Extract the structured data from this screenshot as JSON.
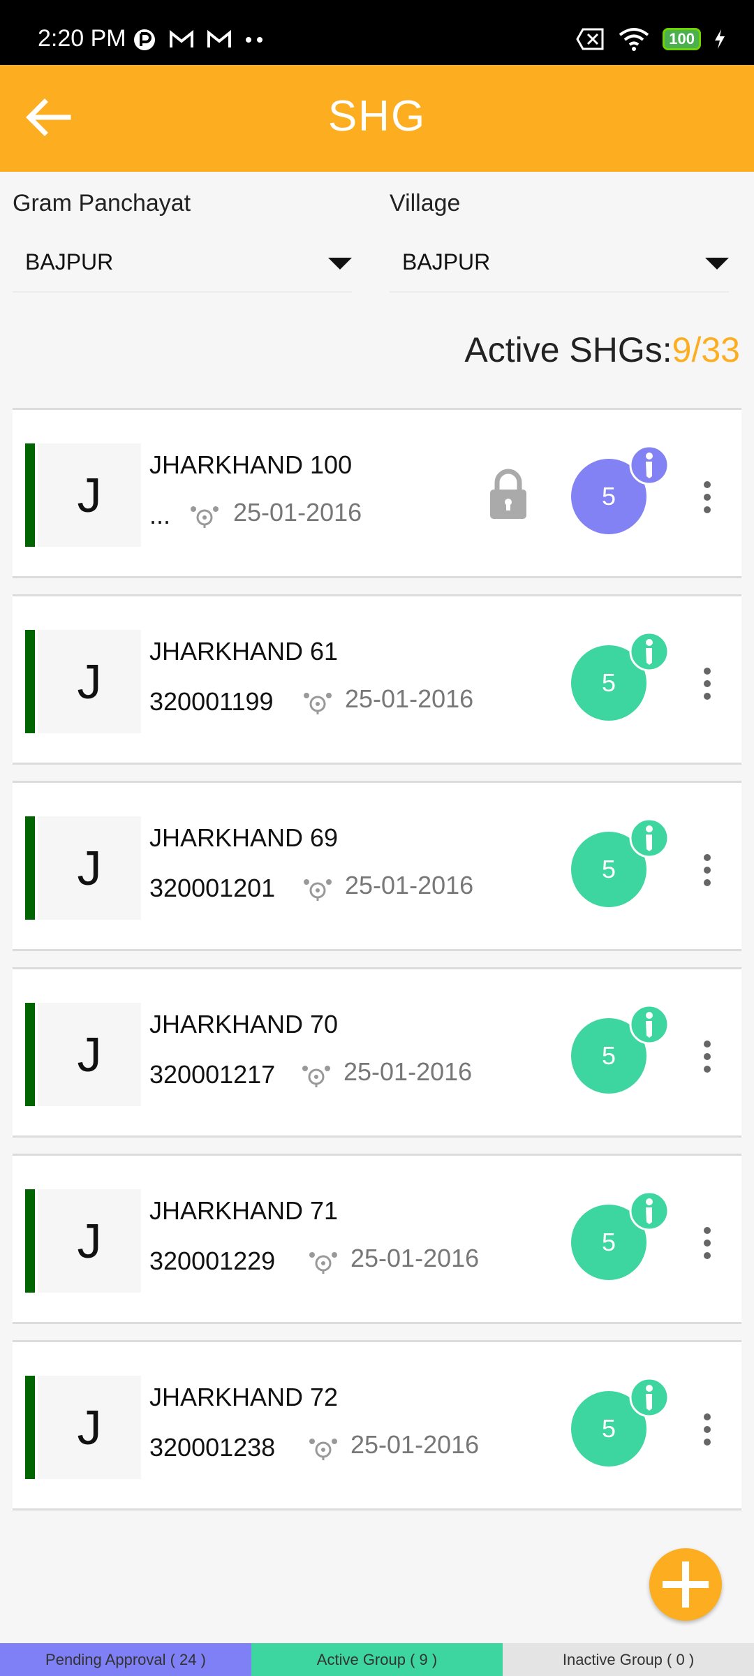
{
  "status_bar": {
    "time": "2:20 PM",
    "battery": "100",
    "icons": [
      "app-icon",
      "gmail-icon",
      "gmail-icon",
      "more-dots-icon",
      "sim-off-icon",
      "wifi-icon",
      "battery-icon",
      "charging-icon"
    ]
  },
  "app_bar": {
    "title": "SHG",
    "back_icon": "arrow-left-icon"
  },
  "filters": {
    "gram_panchayat": {
      "label": "Gram Panchayat",
      "value": "BAJPUR"
    },
    "village": {
      "label": "Village",
      "value": "BAJPUR"
    }
  },
  "active_shgs": {
    "label": "Active SHGs:",
    "value": "9/33"
  },
  "shg_list": [
    {
      "initial": "J",
      "name": "JHARKHAND 100",
      "code": "...",
      "date": "25-01-2016",
      "members": "5",
      "locked": true,
      "color": "#8282f5"
    },
    {
      "initial": "J",
      "name": "JHARKHAND 61",
      "code": "320001199",
      "date": "25-01-2016",
      "members": "5",
      "locked": false,
      "color": "#3dd6a0"
    },
    {
      "initial": "J",
      "name": "JHARKHAND 69",
      "code": "320001201",
      "date": "25-01-2016",
      "members": "5",
      "locked": false,
      "color": "#3dd6a0"
    },
    {
      "initial": "J",
      "name": "JHARKHAND 70",
      "code": "320001217",
      "date": "25-01-2016",
      "members": "5",
      "locked": false,
      "color": "#3dd6a0"
    },
    {
      "initial": "J",
      "name": "JHARKHAND 71",
      "code": "320001229",
      "date": "25-01-2016",
      "members": "5",
      "locked": false,
      "color": "#3dd6a0"
    },
    {
      "initial": "J",
      "name": "JHARKHAND 72",
      "code": "320001238",
      "date": "25-01-2016",
      "members": "5",
      "locked": false,
      "color": "#3dd6a0"
    }
  ],
  "fab": {
    "icon": "plus-icon"
  },
  "bottom_tabs": [
    {
      "label": "Pending Approval ( 24 )",
      "color": "#7f7ff6"
    },
    {
      "label": "Active Group ( 9 )",
      "color": "#3dd6a0"
    },
    {
      "label": "Inactive Group ( 0 )",
      "color": "#e4e4e4"
    }
  ],
  "colors": {
    "accent": "#fdae20",
    "status_bar": "#000000",
    "bar_indicator": "#006400"
  }
}
